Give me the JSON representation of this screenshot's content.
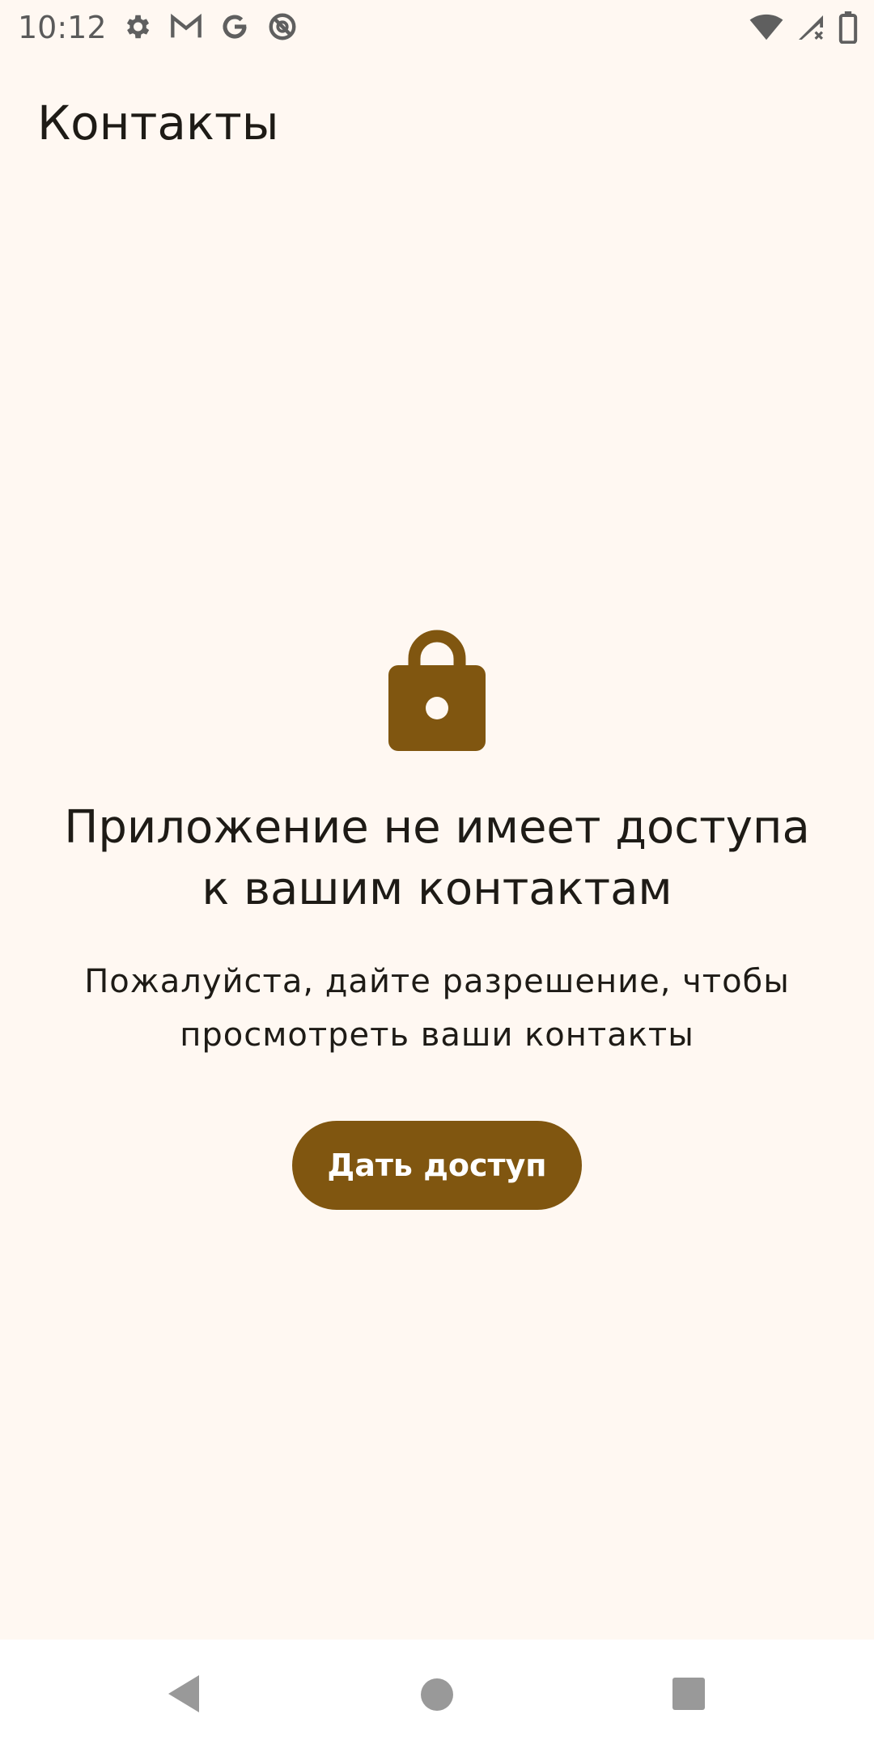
{
  "status_bar": {
    "time": "10:12",
    "left_icons": [
      "gear-icon",
      "gmail-icon",
      "google-icon",
      "no-disturb-icon"
    ],
    "right_icons": [
      "wifi-icon",
      "cell-signal-icon",
      "battery-icon"
    ]
  },
  "app_bar": {
    "title": "Контакты"
  },
  "permission": {
    "icon": "lock-icon",
    "headline": "Приложение не имеет доступа к вашим контактам",
    "message": "Пожалуйста, дайте разрешение, чтобы просмотреть ваши контакты",
    "button_label": "Дать доступ"
  },
  "nav_bar": {
    "buttons": [
      "back-icon",
      "home-icon",
      "recents-icon"
    ]
  },
  "colors": {
    "background": "#fff8f2",
    "accent": "#805610",
    "text": "#1e1b16"
  }
}
